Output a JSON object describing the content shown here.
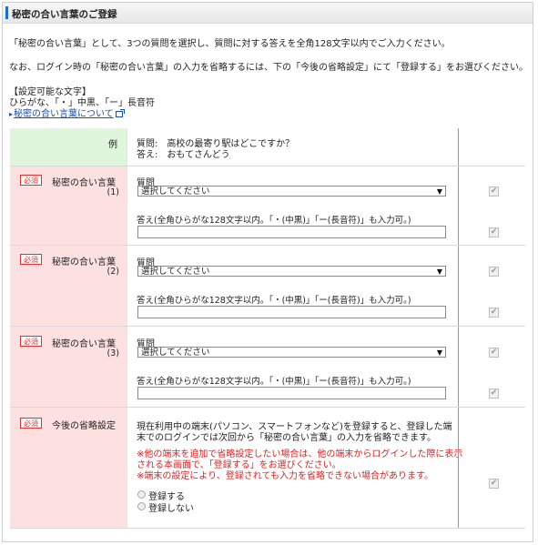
{
  "header": {
    "title": "秘密の合い言葉のご登録"
  },
  "intro": {
    "line1": "「秘密の合い言葉」として、3つの質問を選択し、質問に対する答えを全角128文字以内でご入力ください。",
    "line2": "なお、ログイン時の「秘密の合い言葉」の入力を省略するには、下の「今後の省略設定」にて「登録する」をお選びください。",
    "settable_heading": "【設定可能な文字】",
    "settable_chars": "ひらがな、「・」中黒、「ー」長音符",
    "about_link": "秘密の合い言葉について"
  },
  "example": {
    "label": "例",
    "question": "質問:　高校の最寄り駅はどこですか？",
    "answer": "答え:　おもてさんどう"
  },
  "required_badge": "必須",
  "questions": [
    {
      "label": "秘密の合い言葉",
      "num": "(1)",
      "question_label": "質問",
      "select_value": "選択してください",
      "answer_label": "答え(全角ひらがな128文字以内。「・(中黒)」「ー(長音符)」も入力可。)",
      "answer_value": ""
    },
    {
      "label": "秘密の合い言葉",
      "num": "(2)",
      "question_label": "質問",
      "select_value": "選択してください",
      "answer_label": "答え(全角ひらがな128文字以内。「・(中黒)」「ー(長音符)」も入力可。)",
      "answer_value": ""
    },
    {
      "label": "秘密の合い言葉",
      "num": "(3)",
      "question_label": "質問",
      "select_value": "選択してください",
      "answer_label": "答え(全角ひらがな128文字以内。「・(中黒)」「ー(長音符)」も入力可。)",
      "answer_value": ""
    }
  ],
  "omit": {
    "label": "今後の省略設定",
    "desc1": "現在利用中の端末(パソコン、スマートフォンなど)を登録すると、登録した端",
    "desc2": "末でのログインでは次回から「秘密の合い言葉」の入力を省略できます。",
    "note1a": "※他の端末を追加で省略設定したい場合は、他の端末からログインした際に表示",
    "note1b": "される本画面で、「登録する」をお選びください。",
    "note2": "※端末の設定により、登録されても入力を省略できない場合があります。",
    "opt_register": "登録する",
    "opt_not_register": "登録しない"
  },
  "checkmark": "✔",
  "colors": {
    "accent": "#1e6fc8",
    "required": "#dd3333",
    "label_pink": "#fde0e0",
    "label_green": "#dff5dc",
    "link": "#1a4ea8"
  }
}
